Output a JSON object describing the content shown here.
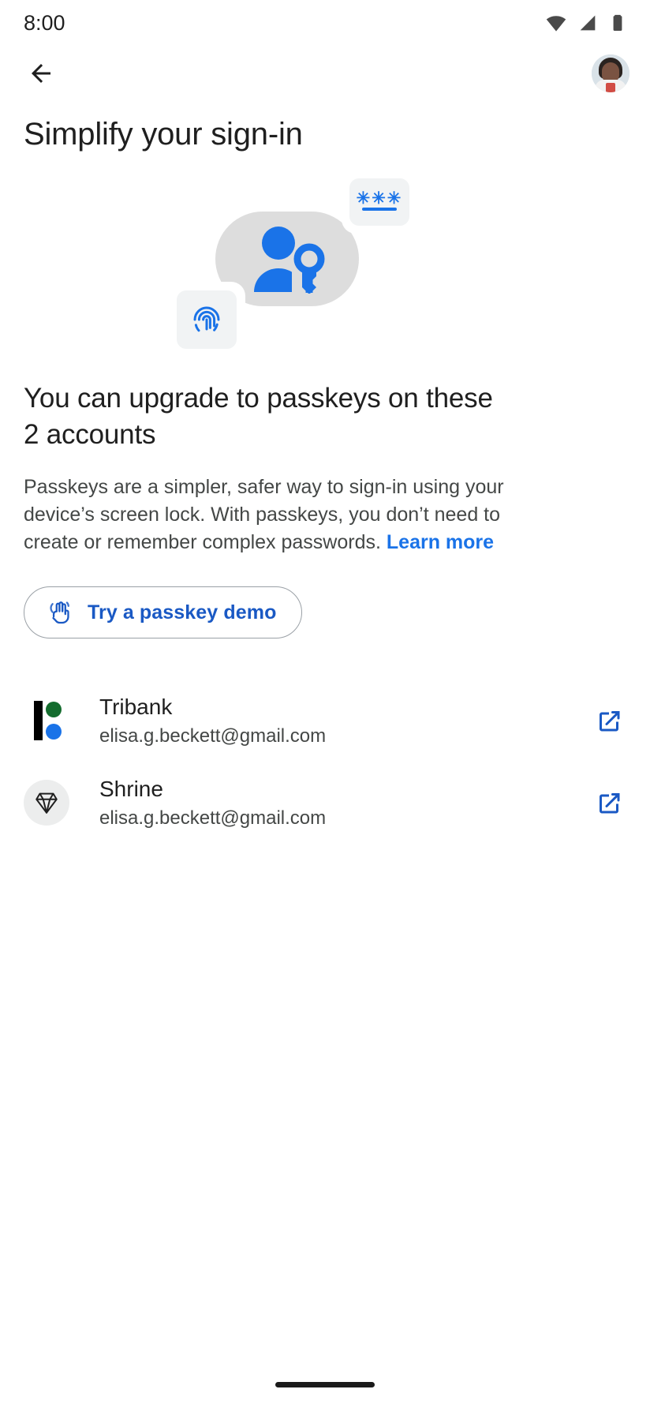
{
  "status_bar": {
    "time": "8:00",
    "icons": [
      "wifi-icon",
      "cellular-signal-icon",
      "battery-icon"
    ]
  },
  "app_bar": {
    "back_icon": "back-arrow-icon",
    "avatar_label": "Account avatar"
  },
  "page": {
    "title": "Simplify your sign-in"
  },
  "hero": {
    "illustration_name": "passkey-hero-illustration",
    "password_card_stars": "✳✳✳",
    "fingerprint_icon": "fingerprint-icon",
    "person_key_icon": "person-with-key-icon"
  },
  "content": {
    "headline": "You can upgrade to passkeys on these 2 accounts",
    "body_part1": "Passkeys are a simpler, safer way to sign-in using your device’s screen lock. With passkeys, you don’t need to create or remember complex passwords. ",
    "learn_more": "Learn more"
  },
  "demo_button": {
    "label": "Try a passkey demo",
    "icon": "touch-hand-icon"
  },
  "accounts": [
    {
      "name": "Tribank",
      "email": "elisa.g.beckett@gmail.com",
      "logo": "tribank-logo",
      "action_icon": "open-in-new-icon"
    },
    {
      "name": "Shrine",
      "email": "elisa.g.beckett@gmail.com",
      "logo": "shrine-diamond-logo",
      "action_icon": "open-in-new-icon"
    }
  ],
  "colors": {
    "accent_blue": "#1a73e8",
    "link_blue": "#1a59c4",
    "text_primary": "#1f1f1f",
    "text_secondary": "#444746",
    "blob_gray": "#dddddd",
    "card_gray": "#f1f3f4",
    "tribank_green": "#146c2e"
  },
  "gesture_bar": {
    "name": "home-gesture-pill"
  }
}
